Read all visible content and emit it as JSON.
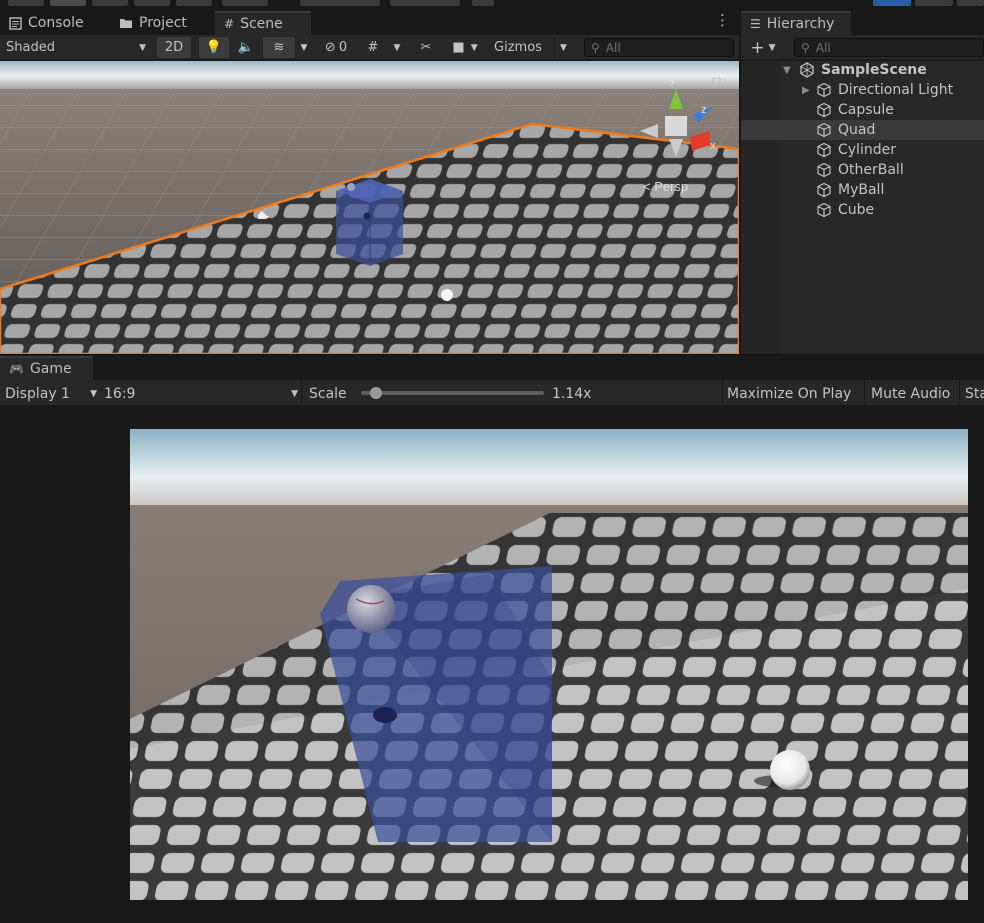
{
  "scene_tabs": [
    {
      "label": "Console",
      "icon": "console-icon"
    },
    {
      "label": "Project",
      "icon": "folder-icon"
    },
    {
      "label": "Scene",
      "icon": "grid-hash-icon"
    }
  ],
  "scene_toolbar": {
    "draw_mode": "Shaded",
    "mode_2d": "2D",
    "hidden_count": "0",
    "gizmos": "Gizmos",
    "search_placeholder": "All"
  },
  "scene_view": {
    "projection_label": "< Persp",
    "axis_labels": {
      "x": "x",
      "y": "y",
      "z": "z"
    }
  },
  "hierarchy": {
    "tab_label": "Hierarchy",
    "search_placeholder": "All",
    "scene_name": "SampleScene",
    "items": [
      {
        "label": "Directional Light",
        "expandable": true,
        "selected": false
      },
      {
        "label": "Capsule",
        "expandable": false,
        "selected": false
      },
      {
        "label": "Quad",
        "expandable": false,
        "selected": true
      },
      {
        "label": "Cylinder",
        "expandable": false,
        "selected": false
      },
      {
        "label": "OtherBall",
        "expandable": false,
        "selected": false
      },
      {
        "label": "MyBall",
        "expandable": false,
        "selected": false
      },
      {
        "label": "Cube",
        "expandable": false,
        "selected": false
      }
    ]
  },
  "game": {
    "tab_label": "Game",
    "display": "Display 1",
    "aspect": "16:9",
    "scale_label": "Scale",
    "scale_value": "1.14x",
    "scale_fraction": 0.08,
    "maximize_on_play": "Maximize On Play",
    "mute_audio": "Mute Audio",
    "stats_partial": "Sta"
  },
  "colors": {
    "selection_outline": "#f07b1c",
    "axis_x": "#e33b2e",
    "axis_y": "#7ec43a",
    "axis_z": "#3c7fe0",
    "panel_bg": "#282828",
    "dark_bg": "#191919"
  }
}
